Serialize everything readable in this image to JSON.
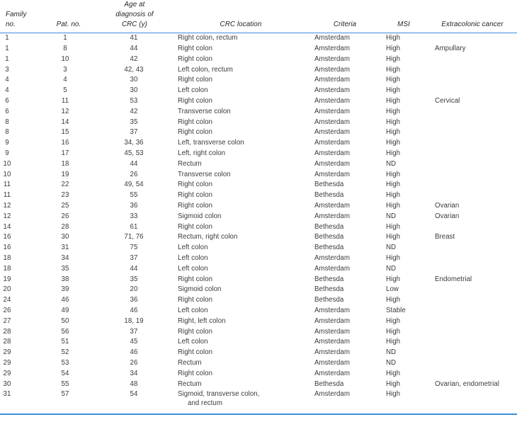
{
  "table": {
    "columns": [
      {
        "key": "family_no",
        "label_lines": [
          "Family",
          "no."
        ]
      },
      {
        "key": "pat_no",
        "label_lines": [
          "Pat. no."
        ]
      },
      {
        "key": "age_at_diagnosis",
        "label_lines": [
          "Age at",
          "diagnosis of",
          "CRC (y)"
        ]
      },
      {
        "key": "crc_location",
        "label_lines": [
          "CRC location"
        ]
      },
      {
        "key": "criteria",
        "label_lines": [
          "Criteria"
        ]
      },
      {
        "key": "msi",
        "label_lines": [
          "MSI"
        ]
      },
      {
        "key": "extracolonic_cancer",
        "label_lines": [
          "Extracolonic cancer"
        ]
      }
    ],
    "header": {
      "family_line1": "Family",
      "family_line2": "no.",
      "pat_no": "Pat. no.",
      "age_line1": "Age at",
      "age_line2": "diagnosis of",
      "age_line3": "CRC (y)",
      "crc_location": "CRC location",
      "criteria": "Criteria",
      "msi": "MSI",
      "extracolonic_cancer": "Extracolonic cancer"
    },
    "rule_color": "#3b8fd4",
    "rows": [
      {
        "family_no": "1",
        "pat_no": "1",
        "age": "41",
        "location": "Right colon, rectum",
        "location_cont": "",
        "criteria": "Amsterdam",
        "msi": "High",
        "extracolonic": ""
      },
      {
        "family_no": "1",
        "pat_no": "8",
        "age": "44",
        "location": "Right colon",
        "location_cont": "",
        "criteria": "Amsterdam",
        "msi": "High",
        "extracolonic": "Ampullary"
      },
      {
        "family_no": "1",
        "pat_no": "10",
        "age": "42",
        "location": "Right colon",
        "location_cont": "",
        "criteria": "Amsterdam",
        "msi": "High",
        "extracolonic": ""
      },
      {
        "family_no": "3",
        "pat_no": "3",
        "age": "42, 43",
        "location": "Left colon, rectum",
        "location_cont": "",
        "criteria": "Amsterdam",
        "msi": "High",
        "extracolonic": ""
      },
      {
        "family_no": "4",
        "pat_no": "4",
        "age": "30",
        "location": "Right colon",
        "location_cont": "",
        "criteria": "Amsterdam",
        "msi": "High",
        "extracolonic": ""
      },
      {
        "family_no": "4",
        "pat_no": "5",
        "age": "30",
        "location": "Left colon",
        "location_cont": "",
        "criteria": "Amsterdam",
        "msi": "High",
        "extracolonic": ""
      },
      {
        "family_no": "6",
        "pat_no": "11",
        "age": "53",
        "location": "Right colon",
        "location_cont": "",
        "criteria": "Amsterdam",
        "msi": "High",
        "extracolonic": "Cervical"
      },
      {
        "family_no": "6",
        "pat_no": "12",
        "age": "42",
        "location": "Transverse colon",
        "location_cont": "",
        "criteria": "Amsterdam",
        "msi": "High",
        "extracolonic": ""
      },
      {
        "family_no": "8",
        "pat_no": "14",
        "age": "35",
        "location": "Right colon",
        "location_cont": "",
        "criteria": "Amsterdam",
        "msi": "High",
        "extracolonic": ""
      },
      {
        "family_no": "8",
        "pat_no": "15",
        "age": "37",
        "location": "Right colon",
        "location_cont": "",
        "criteria": "Amsterdam",
        "msi": "High",
        "extracolonic": ""
      },
      {
        "family_no": "9",
        "pat_no": "16",
        "age": "34, 36",
        "location": "Left, transverse colon",
        "location_cont": "",
        "criteria": "Amsterdam",
        "msi": "High",
        "extracolonic": ""
      },
      {
        "family_no": "9",
        "pat_no": "17",
        "age": "45, 53",
        "location": "Left, right colon",
        "location_cont": "",
        "criteria": "Amsterdam",
        "msi": "High",
        "extracolonic": ""
      },
      {
        "family_no": "10",
        "pat_no": "18",
        "age": "44",
        "location": "Rectum",
        "location_cont": "",
        "criteria": "Amsterdam",
        "msi": "ND",
        "extracolonic": ""
      },
      {
        "family_no": "10",
        "pat_no": "19",
        "age": "26",
        "location": "Transverse colon",
        "location_cont": "",
        "criteria": "Amsterdam",
        "msi": "High",
        "extracolonic": ""
      },
      {
        "family_no": "11",
        "pat_no": "22",
        "age": "49, 54",
        "location": "Right colon",
        "location_cont": "",
        "criteria": "Bethesda",
        "msi": "High",
        "extracolonic": ""
      },
      {
        "family_no": "11",
        "pat_no": "23",
        "age": "55",
        "location": "Right colon",
        "location_cont": "",
        "criteria": "Bethesda",
        "msi": "High",
        "extracolonic": ""
      },
      {
        "family_no": "12",
        "pat_no": "25",
        "age": "36",
        "location": "Right colon",
        "location_cont": "",
        "criteria": "Amsterdam",
        "msi": "High",
        "extracolonic": "Ovarian"
      },
      {
        "family_no": "12",
        "pat_no": "26",
        "age": "33",
        "location": "Sigmoid colon",
        "location_cont": "",
        "criteria": "Amsterdam",
        "msi": "ND",
        "extracolonic": "Ovarian"
      },
      {
        "family_no": "14",
        "pat_no": "28",
        "age": "61",
        "location": "Right colon",
        "location_cont": "",
        "criteria": "Bethesda",
        "msi": "High",
        "extracolonic": ""
      },
      {
        "family_no": "16",
        "pat_no": "30",
        "age": "71, 76",
        "location": "Rectum, right colon",
        "location_cont": "",
        "criteria": "Bethesda",
        "msi": "High",
        "extracolonic": "Breast"
      },
      {
        "family_no": "16",
        "pat_no": "31",
        "age": "75",
        "location": "Left colon",
        "location_cont": "",
        "criteria": "Bethesda",
        "msi": "ND",
        "extracolonic": ""
      },
      {
        "family_no": "18",
        "pat_no": "34",
        "age": "37",
        "location": "Left colon",
        "location_cont": "",
        "criteria": "Amsterdam",
        "msi": "High",
        "extracolonic": ""
      },
      {
        "family_no": "18",
        "pat_no": "35",
        "age": "44",
        "location": "Left colon",
        "location_cont": "",
        "criteria": "Amsterdam",
        "msi": "ND",
        "extracolonic": ""
      },
      {
        "family_no": "19",
        "pat_no": "38",
        "age": "35",
        "location": "Right colon",
        "location_cont": "",
        "criteria": "Bethesda",
        "msi": "High",
        "extracolonic": "Endometrial"
      },
      {
        "family_no": "20",
        "pat_no": "39",
        "age": "20",
        "location": "Sigmoid colon",
        "location_cont": "",
        "criteria": "Bethesda",
        "msi": "Low",
        "extracolonic": ""
      },
      {
        "family_no": "24",
        "pat_no": "46",
        "age": "36",
        "location": "Right colon",
        "location_cont": "",
        "criteria": "Bethesda",
        "msi": "High",
        "extracolonic": ""
      },
      {
        "family_no": "26",
        "pat_no": "49",
        "age": "46",
        "location": "Left colon",
        "location_cont": "",
        "criteria": "Amsterdam",
        "msi": "Stable",
        "extracolonic": ""
      },
      {
        "family_no": "27",
        "pat_no": "50",
        "age": "18, 19",
        "location": "Right, left colon",
        "location_cont": "",
        "criteria": "Amsterdam",
        "msi": "High",
        "extracolonic": ""
      },
      {
        "family_no": "28",
        "pat_no": "56",
        "age": "37",
        "location": "Right colon",
        "location_cont": "",
        "criteria": "Amsterdam",
        "msi": "High",
        "extracolonic": ""
      },
      {
        "family_no": "28",
        "pat_no": "51",
        "age": "45",
        "location": "Left colon",
        "location_cont": "",
        "criteria": "Amsterdam",
        "msi": "High",
        "extracolonic": ""
      },
      {
        "family_no": "29",
        "pat_no": "52",
        "age": "46",
        "location": "Right colon",
        "location_cont": "",
        "criteria": "Amsterdam",
        "msi": "ND",
        "extracolonic": ""
      },
      {
        "family_no": "29",
        "pat_no": "53",
        "age": "26",
        "location": "Rectum",
        "location_cont": "",
        "criteria": "Amsterdam",
        "msi": "ND",
        "extracolonic": ""
      },
      {
        "family_no": "29",
        "pat_no": "54",
        "age": "34",
        "location": "Right colon",
        "location_cont": "",
        "criteria": "Amsterdam",
        "msi": "High",
        "extracolonic": ""
      },
      {
        "family_no": "30",
        "pat_no": "55",
        "age": "48",
        "location": "Rectum",
        "location_cont": "",
        "criteria": "Bethesda",
        "msi": "High",
        "extracolonic": "Ovarian, endometrial"
      },
      {
        "family_no": "31",
        "pat_no": "57",
        "age": "54",
        "location": "Sigmoid, transverse colon,",
        "location_cont": "and rectum",
        "criteria": "Amsterdam",
        "msi": "High",
        "extracolonic": ""
      }
    ]
  }
}
